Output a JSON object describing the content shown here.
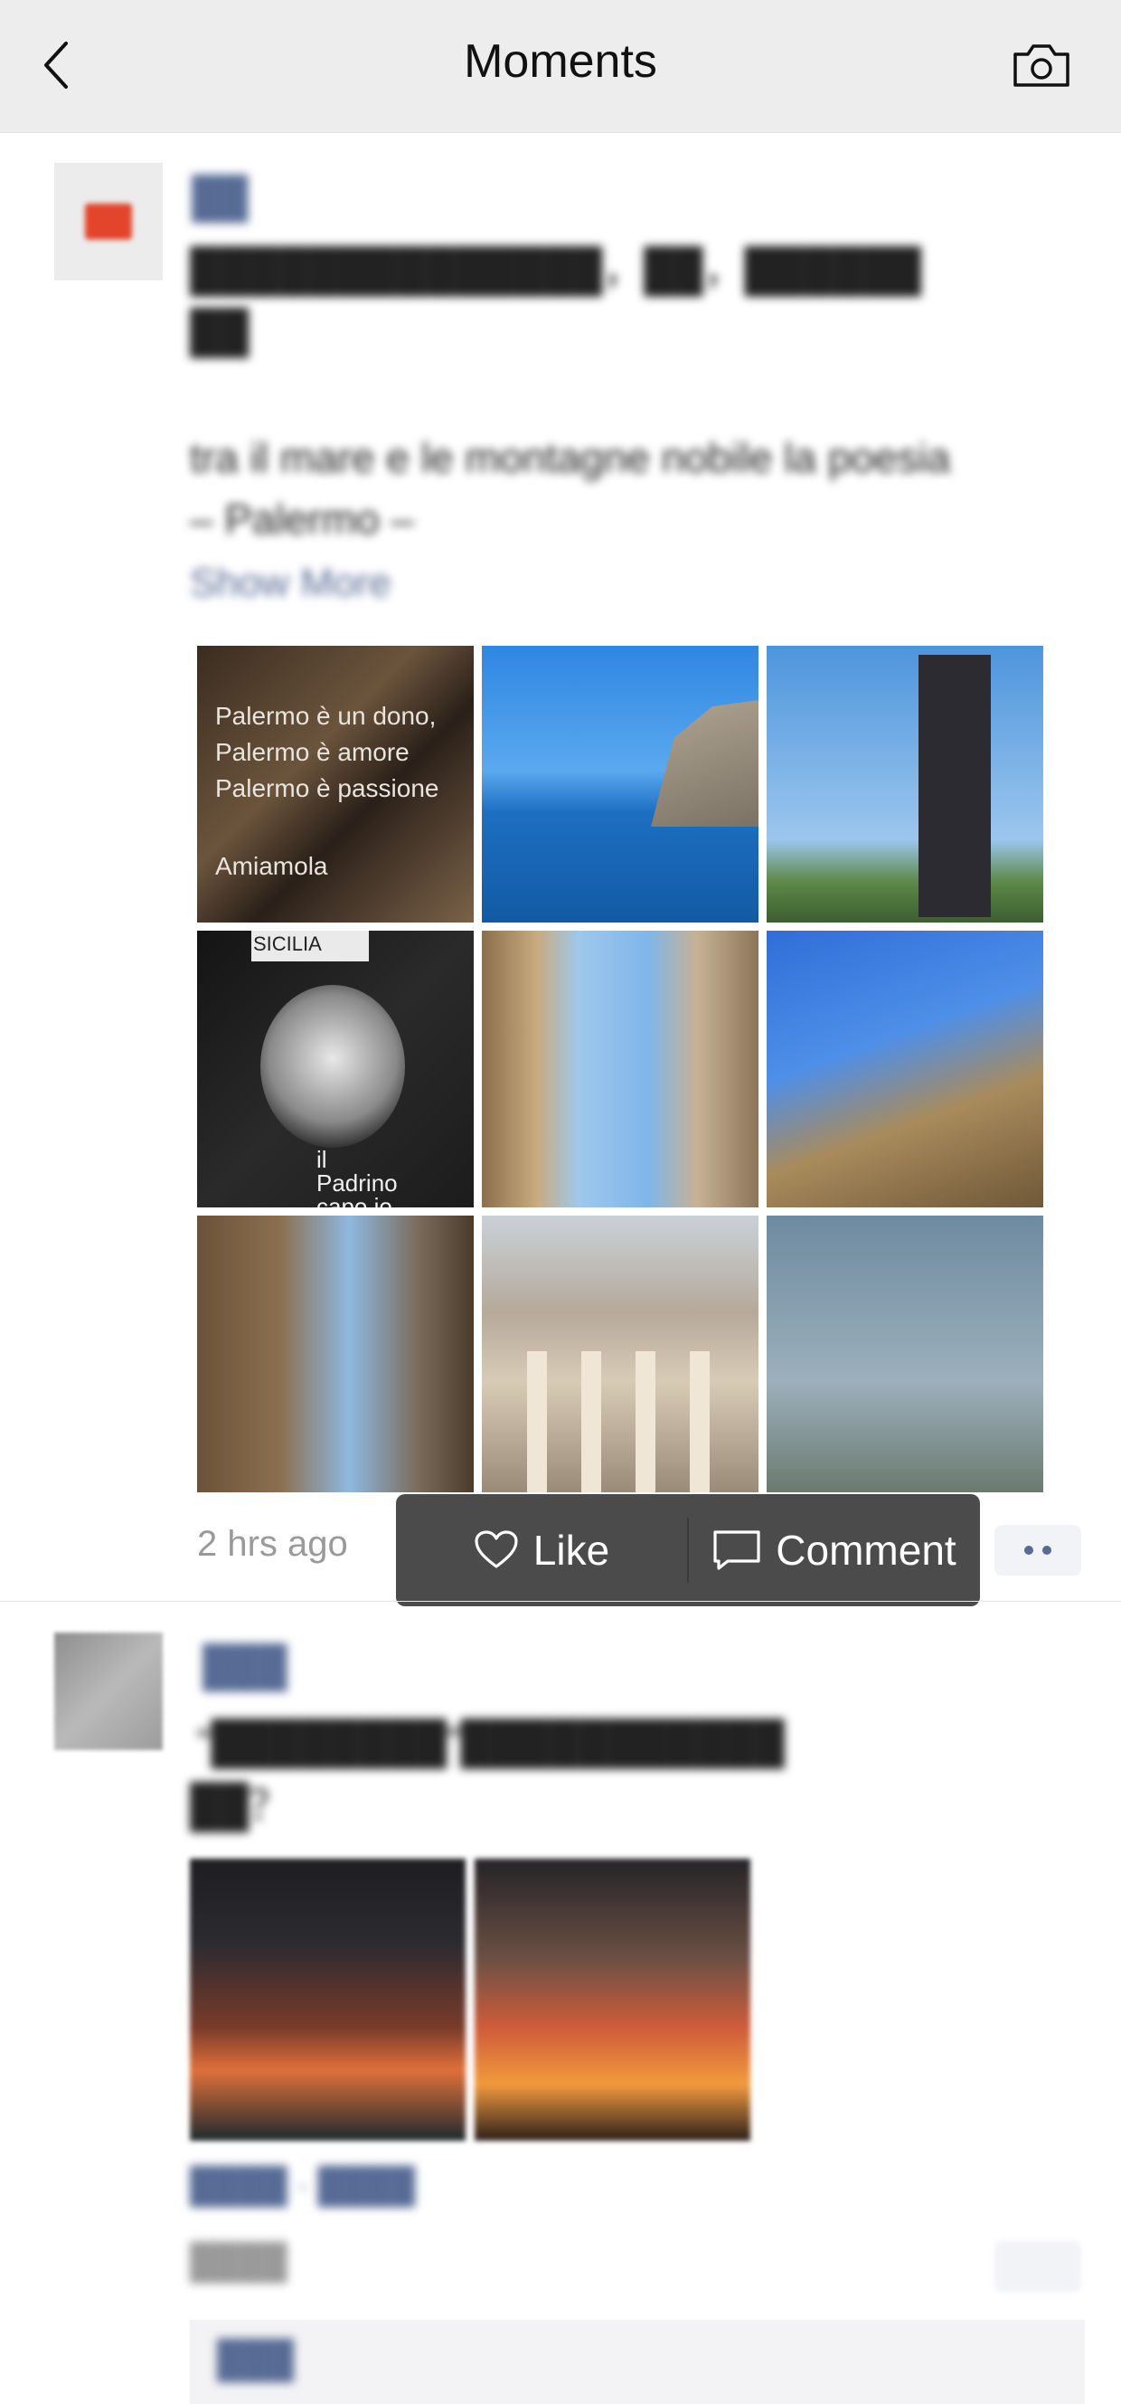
{
  "header": {
    "title": "Moments",
    "back_icon": "chevron-left-icon",
    "camera_icon": "camera-icon"
  },
  "post1": {
    "username": "██",
    "text_line1": "██████████████，██，██████",
    "text_line2": "██",
    "text_line3": "tra il mare e le montagne nobile la poesia",
    "text_line4": "– Palermo –",
    "show_more": "Show More",
    "photos": [
      {
        "caption": "Palermo è un dono, Palermo è amore Palermo è passione Amiamola"
      },
      {
        "caption": ""
      },
      {
        "caption": ""
      },
      {
        "caption": "SICILIA il Padrino capo io"
      },
      {
        "caption": ""
      },
      {
        "caption": ""
      },
      {
        "caption": ""
      },
      {
        "caption": ""
      },
      {
        "caption": ""
      }
    ],
    "time": "2 hrs ago",
    "actions": {
      "like_label": "Like",
      "comment_label": "Comment"
    }
  },
  "post2": {
    "username": "███",
    "text_line1": "“████████”███████████",
    "text_line2": "██？",
    "location": "████ · ████",
    "time": "████",
    "likes": "███"
  },
  "colors": {
    "link": "#576b95",
    "header_bg": "#ededed",
    "popup_bg": "#4b4b4b"
  }
}
